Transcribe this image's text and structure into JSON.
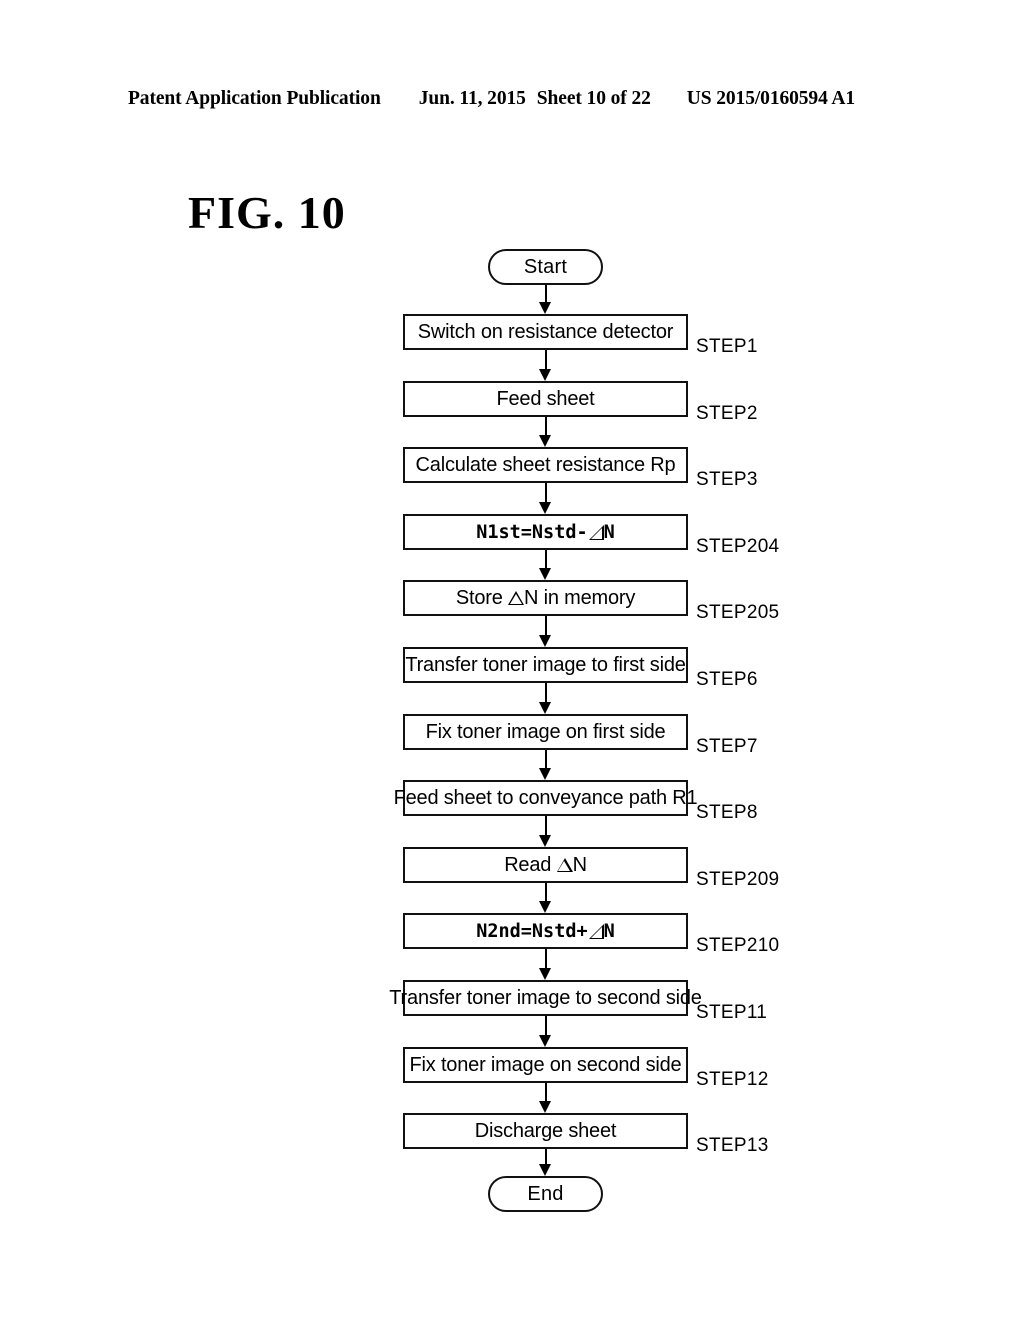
{
  "header": {
    "publication": "Patent Application Publication",
    "date": "Jun. 11, 2015",
    "sheet": "Sheet 10 of 22",
    "doc_number": "US 2015/0160594 A1"
  },
  "figure": {
    "title": "FIG. 10"
  },
  "flowchart": {
    "start_label": "Start",
    "end_label": "End",
    "steps": [
      {
        "text": "Switch on resistance detector",
        "step": "STEP1",
        "mono": false
      },
      {
        "text": "Feed sheet",
        "step": "STEP2",
        "mono": false
      },
      {
        "text": "Calculate sheet resistance Rp",
        "step": "STEP3",
        "mono": false
      },
      {
        "text": "N1st=Nstd-⏩N",
        "step": "STEP204",
        "mono": true
      },
      {
        "text": "Store △N in memory",
        "step": "STEP205",
        "mono": false
      },
      {
        "text": "Transfer toner image to first side",
        "step": "STEP6",
        "mono": false
      },
      {
        "text": "Fix toner image on first side",
        "step": "STEP7",
        "mono": false
      },
      {
        "text": "Feed sheet to conveyance path R1",
        "step": "STEP8",
        "mono": false
      },
      {
        "text": "Read △N",
        "step": "STEP209",
        "mono": false
      },
      {
        "text": "N2nd=Nstd+⏩N",
        "step": "STEP210",
        "mono": true
      },
      {
        "text": "Transfer toner image to second side",
        "step": "STEP11",
        "mono": false
      },
      {
        "text": "Fix toner image on second side",
        "step": "STEP12",
        "mono": false
      },
      {
        "text": "Discharge sheet",
        "step": "STEP13",
        "mono": false
      }
    ]
  },
  "colors": {
    "ink": "#000000",
    "paper": "#ffffff"
  }
}
